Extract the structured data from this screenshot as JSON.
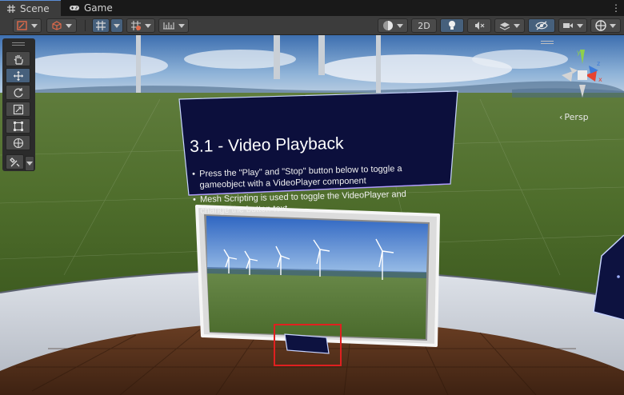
{
  "tabs": [
    {
      "label": "Scene",
      "icon": "grid-icon",
      "active": true
    },
    {
      "label": "Game",
      "icon": "gamepad-icon",
      "active": false
    }
  ],
  "toolbar": {
    "two_d_label": "2D",
    "active_color": "#46607c"
  },
  "tool_palette": {
    "tools": [
      "hand-tool-icon",
      "move-tool-icon",
      "rotate-tool-icon",
      "scale-tool-icon",
      "rect-tool-icon",
      "transform-tool-icon",
      "custom-tool-icon"
    ],
    "active_tool": "move-tool-icon"
  },
  "gizmo": {
    "projection_label": "Persp",
    "axis_colors": {
      "x": "#e8432f",
      "y": "#8fd04a",
      "z": "#3d7bd8"
    }
  },
  "info_panel": {
    "title": "3.1 - Video Playback",
    "bullets": [
      "Press the \"Play\" and \"Stop\" button below to toggle a gameobject with a VideoPlayer component",
      "Mesh Scripting is used to toggle the VideoPlayer and change the button text"
    ]
  },
  "highlight_color": "#e02020"
}
